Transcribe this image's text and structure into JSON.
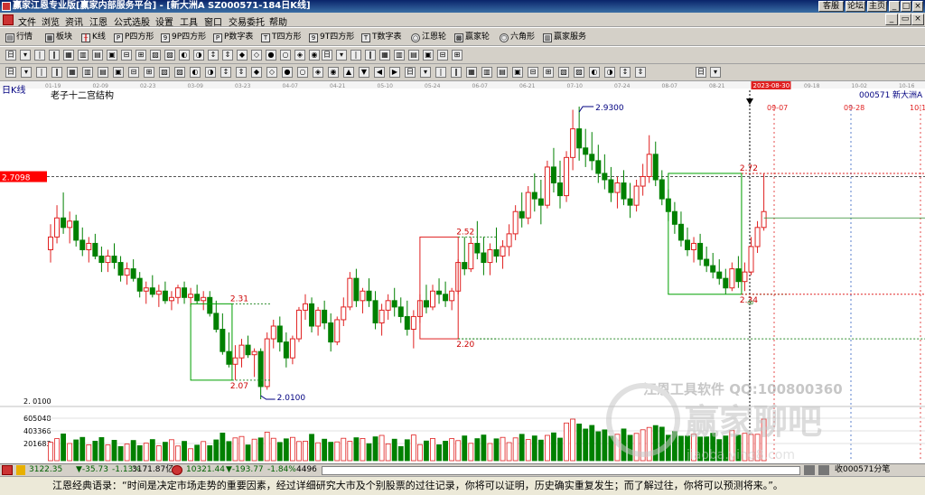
{
  "window": {
    "title": "赢家江恩专业版[赢家内部服务平台] - [新大洲A  SZ000571-184日K线]",
    "buttons": [
      "客服",
      "论坛",
      "主页"
    ]
  },
  "menu": [
    "文件",
    "浏览",
    "资讯",
    "江恩",
    "公式选股",
    "设置",
    "工具",
    "窗口",
    "交易委托",
    "帮助"
  ],
  "toolbar1": [
    "行情",
    "板块",
    "K线",
    "P四方形",
    "9P四方形",
    "P数字表",
    "T四方形",
    "9T四方形",
    "T数字表",
    "江恩轮",
    "赢家轮",
    "六角形",
    "赢家服务"
  ],
  "chart": {
    "period_label": "日K线",
    "study_title": "老子十二宫结构",
    "stock_code": "000571",
    "stock_name": "新大洲A",
    "date_axis": [
      "01-19",
      "02-09",
      "02-23",
      "03-09",
      "03-23",
      "04-07",
      "04-21",
      "05-10",
      "05-24",
      "06-07",
      "06-21",
      "07-10",
      "07-24",
      "08-07",
      "08-21",
      "2023-08-30",
      "09-18",
      "10-02",
      "10-16"
    ],
    "future_dates": [
      "09-07",
      "09-28",
      "10-1"
    ],
    "price_tag": "2.7098",
    "low_label": "2.0100",
    "axis_low": "2. 0100",
    "high_label": "2.9300",
    "box_labels": [
      "2.31",
      "2.07",
      "2.52",
      "2.20",
      "2.72",
      "2.34"
    ],
    "volume_axis": [
      "605048",
      "403366",
      "201683"
    ],
    "watermark1": "江恩工具软件  QQ:100800360",
    "watermark2": "赢家聊吧",
    "watermark_url": "jiaoba.ying8.com",
    "colors": {
      "up": "#e02020",
      "down": "#008000",
      "gann": "#000080"
    }
  },
  "chart_data": {
    "type": "candlestick",
    "title": "老子十二宫结构",
    "symbol": "000571 新大洲A",
    "period": "日K线",
    "ylim": [
      2.01,
      2.93
    ],
    "annotated_levels": [
      2.7098,
      2.93,
      2.01,
      2.31,
      2.07,
      2.52,
      2.2,
      2.72,
      2.34
    ],
    "ohlc": [
      [
        2.48,
        2.56,
        2.44,
        2.52
      ],
      [
        2.52,
        2.62,
        2.5,
        2.58
      ],
      [
        2.58,
        2.66,
        2.53,
        2.55
      ],
      [
        2.55,
        2.6,
        2.5,
        2.57
      ],
      [
        2.57,
        2.59,
        2.49,
        2.51
      ],
      [
        2.51,
        2.55,
        2.46,
        2.48
      ],
      [
        2.48,
        2.52,
        2.44,
        2.5
      ],
      [
        2.5,
        2.53,
        2.45,
        2.46
      ],
      [
        2.46,
        2.49,
        2.41,
        2.44
      ],
      [
        2.44,
        2.48,
        2.41,
        2.46
      ],
      [
        2.46,
        2.5,
        2.42,
        2.44
      ],
      [
        2.44,
        2.46,
        2.38,
        2.4
      ],
      [
        2.4,
        2.44,
        2.37,
        2.42
      ],
      [
        2.42,
        2.45,
        2.38,
        2.39
      ],
      [
        2.39,
        2.41,
        2.33,
        2.35
      ],
      [
        2.35,
        2.38,
        2.31,
        2.36
      ],
      [
        2.36,
        2.4,
        2.33,
        2.34
      ],
      [
        2.34,
        2.37,
        2.3,
        2.35
      ],
      [
        2.35,
        2.38,
        2.31,
        2.32
      ],
      [
        2.32,
        2.35,
        2.29,
        2.33
      ],
      [
        2.33,
        2.37,
        2.31,
        2.36
      ],
      [
        2.36,
        2.38,
        2.31,
        2.33
      ],
      [
        2.33,
        2.36,
        2.3,
        2.34
      ],
      [
        2.34,
        2.37,
        2.31,
        2.32
      ],
      [
        2.32,
        2.35,
        2.29,
        2.33
      ],
      [
        2.33,
        2.35,
        2.27,
        2.28
      ],
      [
        2.28,
        2.32,
        2.22,
        2.23
      ],
      [
        2.23,
        2.28,
        2.15,
        2.16
      ],
      [
        2.16,
        2.22,
        2.11,
        2.12
      ],
      [
        2.12,
        2.18,
        2.07,
        2.14
      ],
      [
        2.14,
        2.2,
        2.11,
        2.18
      ],
      [
        2.18,
        2.21,
        2.14,
        2.15
      ],
      [
        2.15,
        2.17,
        2.08,
        2.16
      ],
      [
        2.16,
        2.17,
        2.01,
        2.05
      ],
      [
        2.05,
        2.22,
        2.04,
        2.2
      ],
      [
        2.2,
        2.26,
        2.17,
        2.24
      ],
      [
        2.24,
        2.27,
        2.16,
        2.19
      ],
      [
        2.19,
        2.22,
        2.11,
        2.14
      ],
      [
        2.14,
        2.21,
        2.12,
        2.2
      ],
      [
        2.2,
        2.3,
        2.19,
        2.29
      ],
      [
        2.29,
        2.34,
        2.26,
        2.31
      ],
      [
        2.31,
        2.33,
        2.22,
        2.24
      ],
      [
        2.24,
        2.3,
        2.21,
        2.29
      ],
      [
        2.29,
        2.32,
        2.23,
        2.25
      ],
      [
        2.25,
        2.28,
        2.16,
        2.19
      ],
      [
        2.19,
        2.27,
        2.18,
        2.26
      ],
      [
        2.26,
        2.33,
        2.24,
        2.3
      ],
      [
        2.3,
        2.41,
        2.29,
        2.39
      ],
      [
        2.39,
        2.42,
        2.3,
        2.32
      ],
      [
        2.32,
        2.36,
        2.28,
        2.35
      ],
      [
        2.35,
        2.39,
        2.3,
        2.32
      ],
      [
        2.32,
        2.35,
        2.23,
        2.25
      ],
      [
        2.25,
        2.31,
        2.21,
        2.29
      ],
      [
        2.29,
        2.34,
        2.26,
        2.32
      ],
      [
        2.32,
        2.36,
        2.27,
        2.3
      ],
      [
        2.3,
        2.33,
        2.25,
        2.27
      ],
      [
        2.27,
        2.32,
        2.21,
        2.23
      ],
      [
        2.23,
        2.29,
        2.17,
        2.27
      ],
      [
        2.27,
        2.34,
        2.25,
        2.32
      ],
      [
        2.32,
        2.37,
        2.28,
        2.3
      ],
      [
        2.3,
        2.37,
        2.29,
        2.35
      ],
      [
        2.35,
        2.39,
        2.31,
        2.34
      ],
      [
        2.34,
        2.38,
        2.3,
        2.32
      ],
      [
        2.32,
        2.36,
        2.29,
        2.35
      ],
      [
        2.35,
        2.45,
        2.34,
        2.44
      ],
      [
        2.44,
        2.52,
        2.4,
        2.42
      ],
      [
        2.42,
        2.52,
        2.41,
        2.5
      ],
      [
        2.5,
        2.57,
        2.45,
        2.47
      ],
      [
        2.47,
        2.52,
        2.4,
        2.44
      ],
      [
        2.44,
        2.5,
        2.4,
        2.48
      ],
      [
        2.48,
        2.55,
        2.44,
        2.46
      ],
      [
        2.46,
        2.51,
        2.42,
        2.49
      ],
      [
        2.49,
        2.56,
        2.46,
        2.53
      ],
      [
        2.53,
        2.62,
        2.51,
        2.6
      ],
      [
        2.6,
        2.66,
        2.55,
        2.58
      ],
      [
        2.58,
        2.68,
        2.56,
        2.66
      ],
      [
        2.66,
        2.72,
        2.6,
        2.64
      ],
      [
        2.64,
        2.7,
        2.56,
        2.62
      ],
      [
        2.62,
        2.76,
        2.61,
        2.74
      ],
      [
        2.74,
        2.8,
        2.66,
        2.69
      ],
      [
        2.69,
        2.76,
        2.61,
        2.65
      ],
      [
        2.65,
        2.79,
        2.63,
        2.77
      ],
      [
        2.77,
        2.92,
        2.73,
        2.86
      ],
      [
        2.86,
        2.93,
        2.76,
        2.8
      ],
      [
        2.8,
        2.86,
        2.74,
        2.78
      ],
      [
        2.78,
        2.85,
        2.73,
        2.76
      ],
      [
        2.76,
        2.81,
        2.69,
        2.72
      ],
      [
        2.72,
        2.78,
        2.67,
        2.7
      ],
      [
        2.7,
        2.74,
        2.63,
        2.66
      ],
      [
        2.66,
        2.71,
        2.61,
        2.69
      ],
      [
        2.69,
        2.73,
        2.62,
        2.64
      ],
      [
        2.64,
        2.69,
        2.58,
        2.62
      ],
      [
        2.62,
        2.7,
        2.6,
        2.68
      ],
      [
        2.68,
        2.75,
        2.65,
        2.71
      ],
      [
        2.71,
        2.84,
        2.69,
        2.78
      ],
      [
        2.78,
        2.82,
        2.68,
        2.7
      ],
      [
        2.7,
        2.73,
        2.62,
        2.64
      ],
      [
        2.64,
        2.67,
        2.57,
        2.6
      ],
      [
        2.6,
        2.63,
        2.53,
        2.56
      ],
      [
        2.56,
        2.6,
        2.49,
        2.51
      ],
      [
        2.51,
        2.55,
        2.46,
        2.48
      ],
      [
        2.48,
        2.52,
        2.44,
        2.5
      ],
      [
        2.5,
        2.53,
        2.43,
        2.45
      ],
      [
        2.45,
        2.49,
        2.41,
        2.43
      ],
      [
        2.43,
        2.47,
        2.39,
        2.41
      ],
      [
        2.41,
        2.45,
        2.37,
        2.39
      ],
      [
        2.39,
        2.42,
        2.34,
        2.36
      ],
      [
        2.36,
        2.44,
        2.35,
        2.42
      ],
      [
        2.42,
        2.46,
        2.36,
        2.38
      ],
      [
        2.38,
        2.44,
        2.35,
        2.41
      ],
      [
        2.41,
        2.52,
        2.4,
        2.49
      ],
      [
        2.49,
        2.57,
        2.47,
        2.55
      ],
      [
        2.55,
        2.72,
        2.54,
        2.6
      ]
    ],
    "volume_axis": [
      605048,
      403366,
      201683
    ]
  },
  "status": {
    "sh_index": "3122.35",
    "sh_change": "▼-35.73",
    "sh_pct": "-1.13%",
    "sh_amount": "3171.87亿",
    "sz_index": "10321.44",
    "sz_change": "▼-193.77",
    "sz_pct": "-1.84%",
    "sz_amount": "4496",
    "right_text": "收000571分笔"
  },
  "quote": "江恩经典语录：“时间是决定市场走势的重要因素，经过详细研究大市及个别股票的过往记录，你将可以证明，历史确实重复发生；而了解过往，你将可以预测将来。”。"
}
